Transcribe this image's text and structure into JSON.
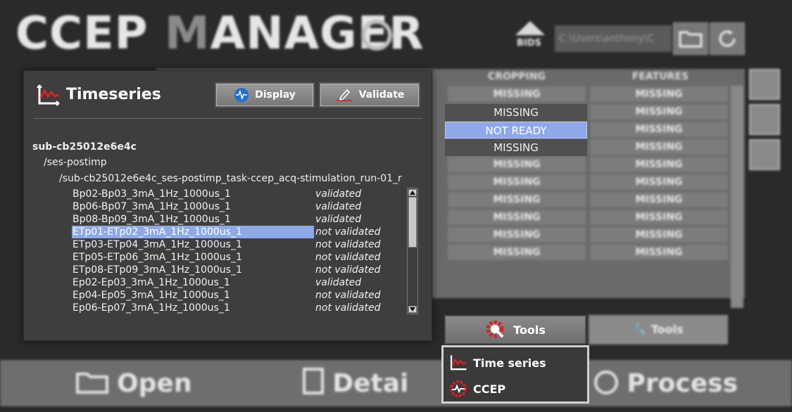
{
  "app": {
    "title_light": "CCEP ",
    "title_dim": "M",
    "title_rest": "ANAGER",
    "bids_label": "BIDS",
    "path_value": "C:\\Users\\anthony\\C"
  },
  "table": {
    "headers": [
      "CROPPING",
      "FEATURES"
    ],
    "cropping": [
      "MISSING",
      "MISSING",
      "NOT READY",
      "MISSING",
      "MISSING",
      "MISSING",
      "MISSING",
      "MISSING",
      "MISSING",
      "MISSING"
    ],
    "features": [
      "MISSING",
      "MISSING",
      "MISSING",
      "MISSING",
      "MISSING",
      "MISSING",
      "MISSING",
      "MISSING",
      "MISSING",
      "MISSING"
    ]
  },
  "timeseries": {
    "title": "Timeseries",
    "display_label": "Display",
    "validate_label": "Validate",
    "subject": "sub-cb25012e6e4c",
    "session": "/ses-postimp",
    "run": "/sub-cb25012e6e4c_ses-postimp_task-ccep_acq-stimulation_run-01_r",
    "files": [
      {
        "name": "Bp02-Bp03_3mA_1Hz_1000us_1",
        "status": "validated",
        "selected": false
      },
      {
        "name": "Bp06-Bp07_3mA_1Hz_1000us_1",
        "status": "validated",
        "selected": false
      },
      {
        "name": "Bp08-Bp09_3mA_1Hz_1000us_1",
        "status": "validated",
        "selected": false
      },
      {
        "name": "ETp01-ETp02_3mA_1Hz_1000us_1",
        "status": "not validated",
        "selected": true
      },
      {
        "name": "ETp03-ETp04_3mA_1Hz_1000us_1",
        "status": "not validated",
        "selected": false
      },
      {
        "name": "ETp05-ETp06_3mA_1Hz_1000us_1",
        "status": "not validated",
        "selected": false
      },
      {
        "name": "ETp08-ETp09_3mA_1Hz_1000us_1",
        "status": "not validated",
        "selected": false
      },
      {
        "name": "Ep02-Ep03_3mA_1Hz_1000us_1",
        "status": "validated",
        "selected": false
      },
      {
        "name": "Ep04-Ep05_3mA_1Hz_1000us_1",
        "status": "not validated",
        "selected": false
      },
      {
        "name": "Ep06-Ep07_3mA_1Hz_1000us_1",
        "status": "not validated",
        "selected": false
      }
    ]
  },
  "tools": {
    "button_label": "Tools",
    "bg_button_label": "Tools",
    "menu": [
      {
        "label": "Time series",
        "icon": "timeseries-icon"
      },
      {
        "label": "CCEP",
        "icon": "ccep-icon"
      }
    ]
  },
  "bottom": {
    "open_label": "Open",
    "details_label": "Detai",
    "process_label": "Process"
  },
  "colors": {
    "selection": "#8ea8e8",
    "panel": "#3e3e3e",
    "accent_red": "#e02020"
  }
}
